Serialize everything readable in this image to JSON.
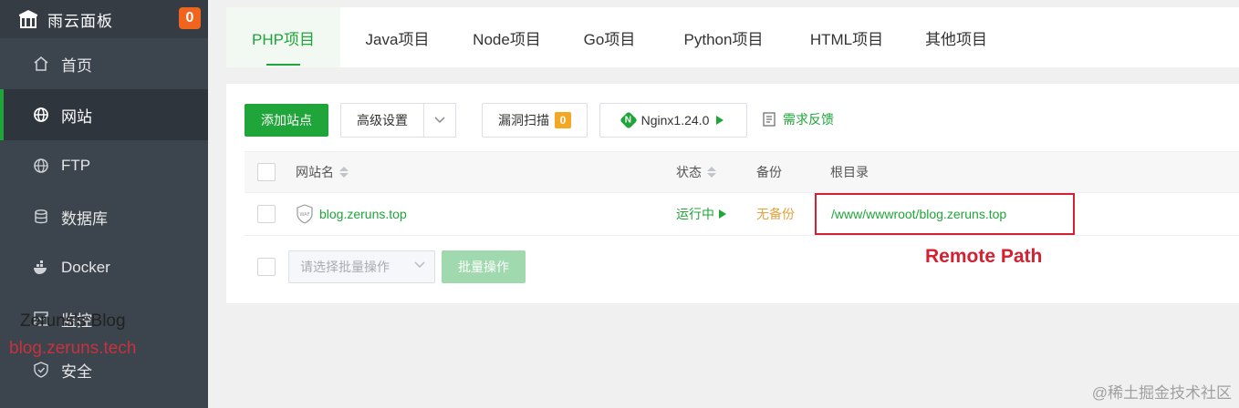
{
  "app": {
    "brand": "雨云面板",
    "notification_count": "0"
  },
  "sidebar": {
    "items": [
      {
        "label": "首页",
        "icon": "home-icon"
      },
      {
        "label": "网站",
        "icon": "globe-icon",
        "active": true
      },
      {
        "label": "FTP",
        "icon": "ftp-globe-icon"
      },
      {
        "label": "数据库",
        "icon": "database-icon"
      },
      {
        "label": "Docker",
        "icon": "docker-icon"
      },
      {
        "label": "监控",
        "icon": "monitor-icon"
      },
      {
        "label": "安全",
        "icon": "shield-icon"
      }
    ]
  },
  "watermark": {
    "line1": "Zeruns's Blog",
    "line2": "blog.zeruns.tech"
  },
  "tabs": [
    "PHP项目",
    "Java项目",
    "Node项目",
    "Go项目",
    "Python项目",
    "HTML项目",
    "其他项目"
  ],
  "toolbar": {
    "add_site": "添加站点",
    "advanced": "高级设置",
    "vuln_scan": "漏洞扫描",
    "vuln_count": "0",
    "nginx": "Nginx1.24.0",
    "feedback": "需求反馈"
  },
  "table": {
    "headers": {
      "name": "网站名",
      "status": "状态",
      "backup": "备份",
      "root": "根目录"
    },
    "rows": [
      {
        "name": "blog.zeruns.top",
        "status": "运行中",
        "backup": "无备份",
        "root": "/www/wwwroot/blog.zeruns.top"
      }
    ]
  },
  "batch": {
    "placeholder": "请选择批量操作",
    "button": "批量操作"
  },
  "annotation": "Remote Path",
  "corner_watermark": "@稀土掘金技术社区",
  "colors": {
    "accent": "#20a53a",
    "sidebar_bg": "#3c444d",
    "highlight": "#d42030",
    "warning": "#e6a23c"
  }
}
